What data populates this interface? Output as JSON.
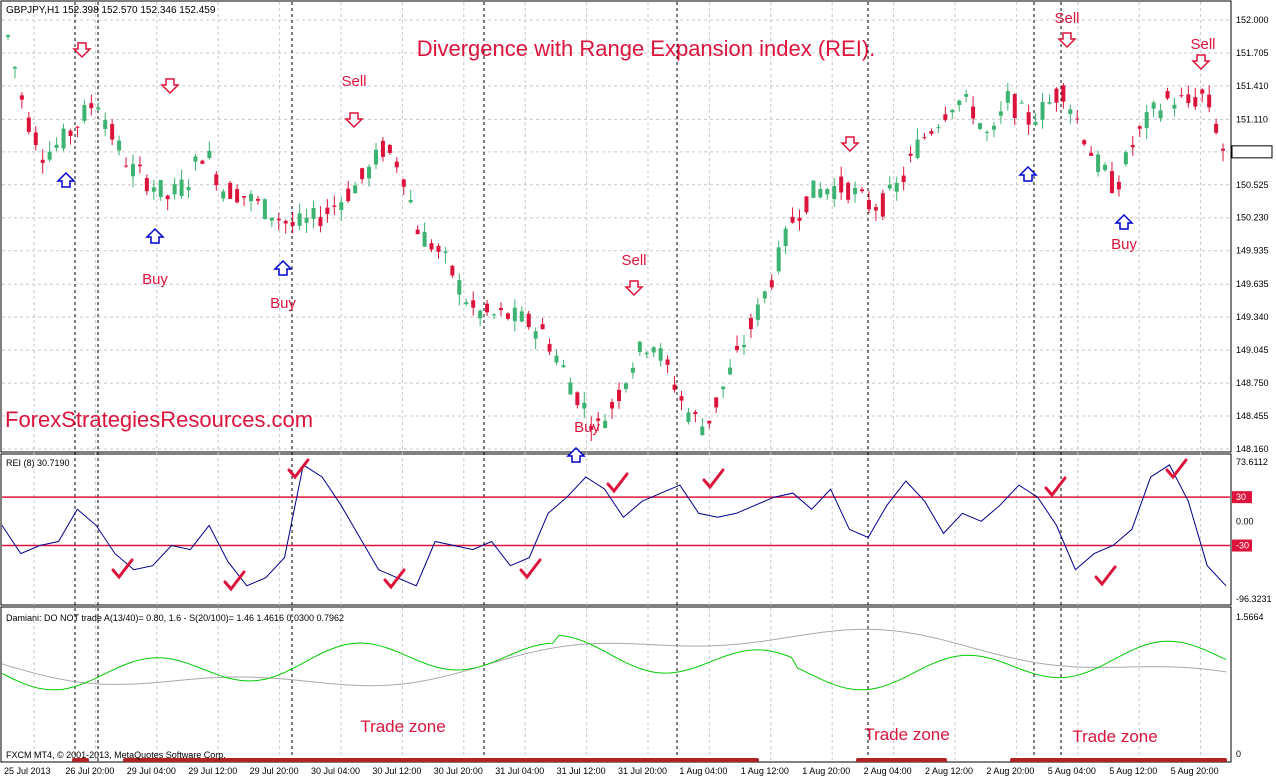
{
  "header": {
    "symbol_info": "GBPJPY,H1  152.398 152.570 152.346 152.459",
    "title": "Divergence with Range Expansion index (REI).",
    "watermark": "ForexStrategiesResources.com"
  },
  "colors": {
    "bull": "#3cb371",
    "bear": "#dc143c",
    "annotation": "#dc143c",
    "buy_arrow": "#0000cd",
    "sell_arrow": "#dc143c",
    "rei_line": "#00008b",
    "rei_levels": "#dc143c",
    "damiani_green": "#00cc00",
    "damiani_gray": "#a9a9a9",
    "trade_zone_bar": "#b22222"
  },
  "chart_data": {
    "type": "line",
    "symbol": "GBPJPY",
    "timeframe": "H1",
    "price_axis": {
      "ticks": [
        "152.000",
        "151.705",
        "151.410",
        "151.110",
        "150.820",
        "150.525",
        "150.230",
        "149.935",
        "149.635",
        "149.340",
        "149.045",
        "148.750",
        "148.455",
        "148.160"
      ],
      "ylim": [
        148.16,
        152.0
      ],
      "last_price": 150.82,
      "close_path": [
        151.85,
        151.15,
        150.8,
        150.9,
        151.1,
        151.3,
        150.9,
        150.65,
        150.55,
        150.4,
        150.55,
        150.85,
        150.5,
        150.45,
        150.35,
        150.25,
        150.15,
        150.2,
        150.3,
        150.45,
        150.6,
        150.85,
        150.7,
        150.1,
        149.95,
        149.7,
        149.4,
        149.35,
        149.35,
        149.3,
        149.2,
        148.9,
        148.6,
        148.35,
        148.6,
        148.95,
        149.15,
        148.85,
        148.5,
        148.35,
        148.7,
        149.05,
        149.4,
        149.8,
        150.25,
        150.45,
        150.5,
        150.5,
        150.35,
        150.35,
        150.55,
        150.9,
        151.1,
        151.3,
        151.2,
        150.9,
        151.3,
        151.1,
        151.2,
        151.4,
        151.05,
        150.7,
        150.5,
        150.9,
        151.15,
        151.3,
        151.25,
        151.35,
        150.85
      ]
    },
    "time_axis": [
      "25 Jul 2013",
      "26 Jul 20:00",
      "29 Jul 04:00",
      "29 Jul 12:00",
      "29 Jul 20:00",
      "30 Jul 04:00",
      "30 Jul 12:00",
      "30 Jul 20:00",
      "31 Jul 04:00",
      "31 Jul 12:00",
      "31 Jul 20:00",
      "1 Aug 04:00",
      "1 Aug 12:00",
      "1 Aug 20:00",
      "2 Aug 04:00",
      "2 Aug 12:00",
      "2 Aug 20:00",
      "5 Aug 04:00",
      "5 Aug 12:00",
      "5 Aug 20:00"
    ],
    "signals": [
      {
        "label": "Sell",
        "type": "sell",
        "position": "on"
      },
      {
        "label": "",
        "type": "sell",
        "position": "on"
      },
      {
        "label": "Sell",
        "type": "sell",
        "position": "above"
      },
      {
        "label": "Sell",
        "type": "sell",
        "position": "above"
      },
      {
        "label": "",
        "type": "sell",
        "position": "on"
      },
      {
        "label": "Sell",
        "type": "sell",
        "position": "above"
      },
      {
        "label": "Sell",
        "type": "sell",
        "position": "above"
      },
      {
        "label": "",
        "type": "buy",
        "position": "on"
      },
      {
        "label": "Buy",
        "type": "buy",
        "position": "below"
      },
      {
        "label": "Buy",
        "type": "buy",
        "position": "below"
      },
      {
        "label": "Buy",
        "type": "buy",
        "position": "beside"
      },
      {
        "label": "",
        "type": "buy",
        "position": "on"
      },
      {
        "label": "Buy",
        "type": "buy",
        "position": "below"
      }
    ],
    "rei": {
      "label": "REI (8) 30.7190",
      "ticks": [
        "73.6112",
        "30",
        "0.00",
        "-30",
        "-96.3231"
      ],
      "ylim": [
        -96.3231,
        73.6112
      ],
      "levels": [
        30,
        -30
      ],
      "values": [
        -5,
        -40,
        -30,
        -25,
        15,
        -5,
        -40,
        -60,
        -55,
        -30,
        -35,
        -5,
        -50,
        -80,
        -70,
        -45,
        70,
        55,
        20,
        -20,
        -60,
        -70,
        -80,
        -25,
        -30,
        -35,
        -25,
        -55,
        -45,
        10,
        30,
        55,
        40,
        5,
        25,
        35,
        45,
        10,
        5,
        10,
        20,
        30,
        35,
        15,
        40,
        -10,
        -20,
        20,
        50,
        25,
        -15,
        10,
        0,
        20,
        45,
        30,
        -5,
        -60,
        -40,
        -30,
        -10,
        55,
        70,
        25,
        -55,
        -80
      ]
    },
    "damiani": {
      "label": "Damiani: DO NOT trade A(13/40)= 0.80, 1.6 - S(20/100)= 1.46  1.4616 0.0300 0.7962",
      "ticks": [
        "1.5664",
        "0"
      ]
    },
    "annotations": {
      "trade_zones": [
        "Trade zone",
        "Trade zone",
        "Trade zone"
      ],
      "checkmarks": 12
    }
  },
  "footer": {
    "copyright": "FXCM MT4, © 2001-2013, MetaQuotes Software Corp."
  }
}
